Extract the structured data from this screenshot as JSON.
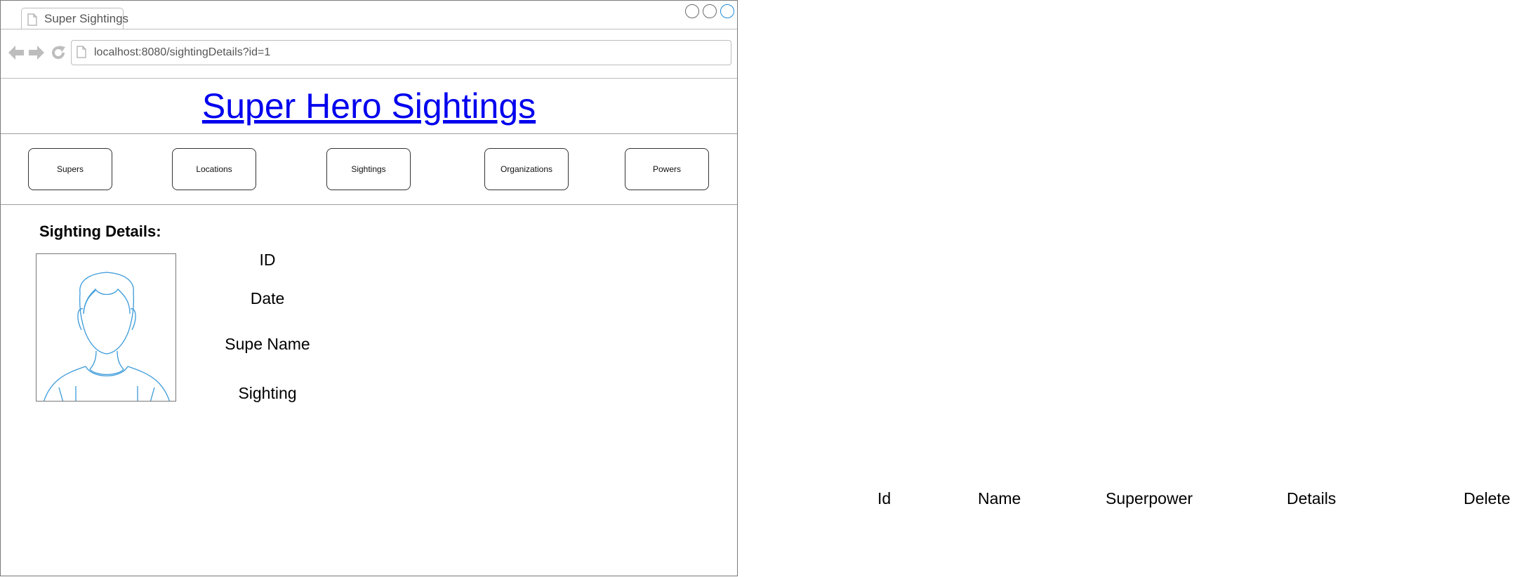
{
  "browser": {
    "tab_title": "Super Sightings",
    "url": "localhost:8080/sightingDetails?id=1"
  },
  "header": {
    "title": "Super Hero Sightings"
  },
  "nav": {
    "buttons": [
      "Supers",
      "Locations",
      "Sightings",
      "Organizations",
      "Powers"
    ]
  },
  "details": {
    "section_title": "Sighting Details:",
    "fields": [
      "ID",
      "Date",
      "Supe Name",
      "Sighting"
    ]
  },
  "table": {
    "headers": [
      "Id",
      "Name",
      "Superpower",
      "Details",
      "Delete"
    ]
  },
  "colors": {
    "link": "#0000ee",
    "avatar_stroke": "#3a9ad9",
    "window_control_active": "#1f8bd6"
  },
  "icons": [
    "document-icon",
    "back-arrow-icon",
    "forward-arrow-icon",
    "reload-icon",
    "user-avatar-icon"
  ]
}
